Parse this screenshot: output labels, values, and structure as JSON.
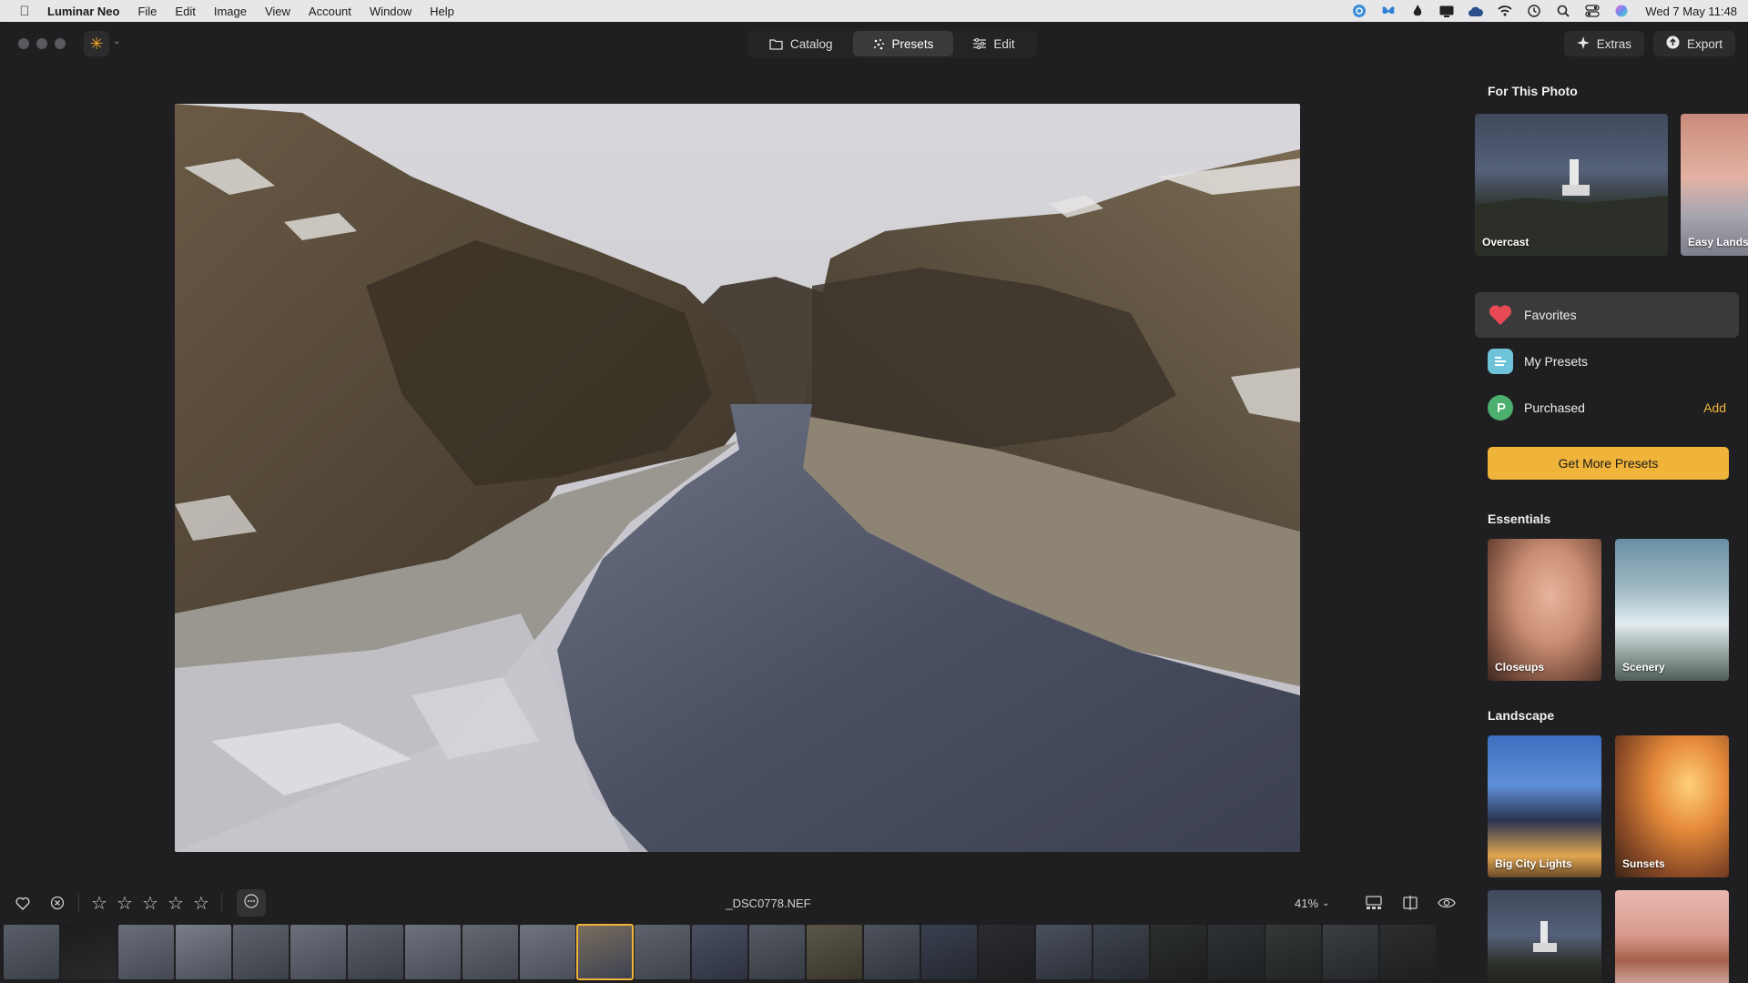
{
  "menubar": {
    "app_name": "Luminar Neo",
    "items": [
      "File",
      "Edit",
      "Image",
      "View",
      "Account",
      "Window",
      "Help"
    ],
    "clock": "Wed 7 May  11:48"
  },
  "toolbar": {
    "tabs": [
      {
        "label": "Catalog",
        "icon": "folder-icon"
      },
      {
        "label": "Presets",
        "icon": "presets-icon"
      },
      {
        "label": "Edit",
        "icon": "sliders-icon"
      }
    ],
    "active_tab": "Presets",
    "extras_label": "Extras",
    "export_label": "Export"
  },
  "photo": {
    "filename": "_DSC0778.NEF",
    "zoom": "41%"
  },
  "rating": {
    "stars": 5,
    "value": 0
  },
  "filmstrip": {
    "count": 25,
    "selected_index": 10
  },
  "panel": {
    "for_this_photo_title": "For This Photo",
    "for_this_photo": [
      {
        "label": "Overcast"
      },
      {
        "label": "Easy Lands"
      }
    ],
    "collections": [
      {
        "label": "Favorites",
        "icon": "heart-icon",
        "active": true
      },
      {
        "label": "My Presets",
        "icon": "my-presets-icon",
        "active": false
      },
      {
        "label": "Purchased",
        "icon": "purchased-icon",
        "active": false,
        "action": "Add"
      }
    ],
    "get_more_label": "Get More Presets",
    "essentials_title": "Essentials",
    "essentials": [
      {
        "label": "Closeups"
      },
      {
        "label": "Scenery"
      }
    ],
    "landscape_title": "Landscape",
    "landscape": [
      {
        "label": "Big City Lights"
      },
      {
        "label": "Sunsets"
      },
      {
        "label": ""
      },
      {
        "label": ""
      }
    ]
  },
  "colors": {
    "accent": "#f0b43a",
    "background": "#1f1f21",
    "panel_row_active": "#3a3a3c"
  }
}
